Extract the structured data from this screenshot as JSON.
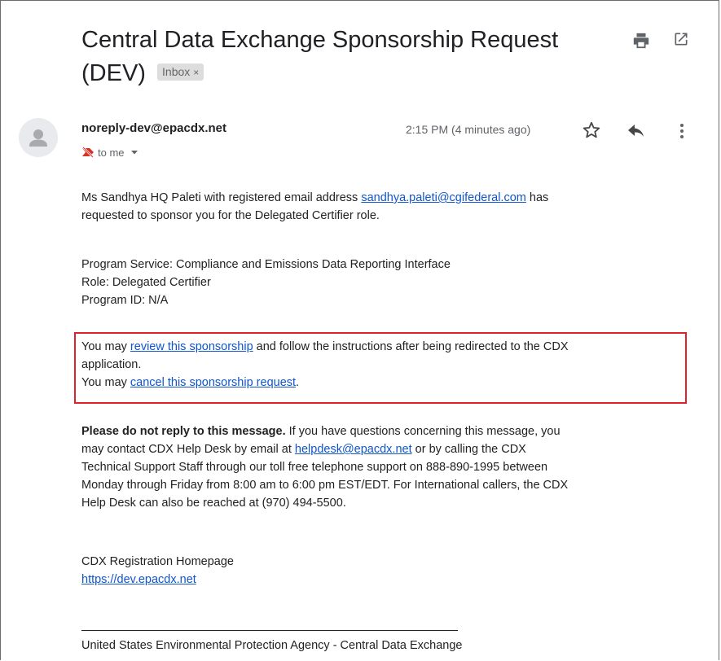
{
  "email": {
    "subject": "Central Data Exchange Sponsorship Request (DEV)",
    "subject_line1": "Central Data Exchange Sponsorship Request",
    "subject_line2": "(DEV)",
    "label_chip": "Inbox",
    "label_remove": "×",
    "sender": "noreply-dev@epacdx.net",
    "time": "2:15 PM (4 minutes ago)",
    "recipients": "to me",
    "body": {
      "p1": {
        "before": "Ms Sandhya HQ Paleti with registered email address ",
        "email_link": "sandhya.paleti@cgifederal.com",
        "after": " has",
        "line2": "requested to sponsor you for the Delegated Certifier role."
      },
      "p2": {
        "line1": "Program Service: Compliance and Emissions Data Reporting Interface",
        "line2": "Role: Delegated Certifier",
        "line3": "Program ID: N/A"
      },
      "p3": {
        "l1_before": "You may ",
        "review_link": "review this sponsorship",
        "l1_after": " and follow the instructions after being redirected to the CDX",
        "line2": "application.",
        "l3_before": "You may ",
        "cancel_link": "cancel this sponsorship request",
        "l3_after": "."
      },
      "p4": {
        "bold": "Please do not reply to this message.",
        "l1_after": " If you have questions concerning this message, you",
        "l2_before": "may contact CDX Help Desk by email at ",
        "helpdesk_link": "helpdesk@epacdx.net",
        "l2_after": " or by calling the CDX",
        "line3": "Technical Support Staff through our toll free telephone support on 888-890-1995 between",
        "line4": "Monday through Friday from 8:00 am to 6:00 pm EST/EDT. For International callers, the CDX",
        "line5": "Help Desk can also be reached at (970) 494-5500."
      },
      "p5": {
        "line1": "CDX Registration Homepage",
        "homepage_link": "https://dev.epacdx.net"
      },
      "p6": {
        "line1": "United States Environmental Protection Agency - Central Data Exchange"
      }
    }
  },
  "icons": {
    "print": "printer-icon",
    "popout": "open-in-new-window-icon",
    "star": "star-outline-icon",
    "reply": "reply-arrow-icon",
    "more": "vertical-ellipsis-icon",
    "avatar": "default-person-avatar-icon",
    "importance": "not-important-marker-icon",
    "dropdown": "caret-down-icon"
  },
  "colors": {
    "link": "#1155cc",
    "highlight_box": "#e0202a",
    "importance_marker": "#d93025",
    "chip_bg": "#dddddd"
  }
}
